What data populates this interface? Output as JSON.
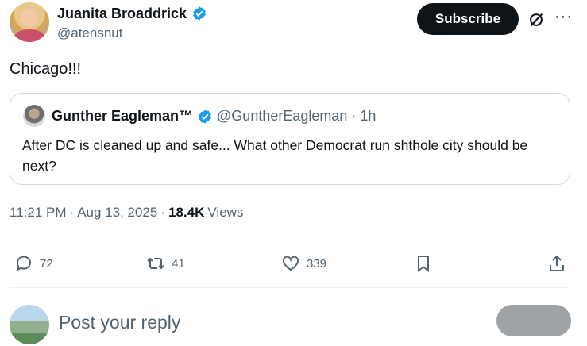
{
  "author": {
    "name": "Juanita Broaddrick",
    "handle": "@atensnut"
  },
  "header": {
    "subscribe_label": "Subscribe",
    "more_label": "···"
  },
  "tweet": {
    "text": "Chicago!!!"
  },
  "quote": {
    "name": "Gunther Eagleman™",
    "handle": "@GuntherEagleman",
    "separator": "·",
    "time": "1h",
    "text": "After DC is cleaned up and safe...  What other Democrat run shthole city should be next?"
  },
  "meta": {
    "time": "11:21 PM",
    "sep1": "·",
    "date": "Aug 13, 2025",
    "sep2": "·",
    "views_count": "18.4K",
    "views_label": "Views"
  },
  "actions": {
    "replies": "72",
    "reposts": "41",
    "likes": "339"
  },
  "reply": {
    "placeholder": "Post your reply"
  },
  "colors": {
    "verified": "#1d9bf0",
    "text": "#0f1419",
    "secondary": "#536471",
    "border": "#cfd9de"
  },
  "icons": [
    "verified-badge-icon",
    "grok-icon",
    "more-icon",
    "reply-icon",
    "repost-icon",
    "like-icon",
    "bookmark-icon",
    "share-icon"
  ]
}
